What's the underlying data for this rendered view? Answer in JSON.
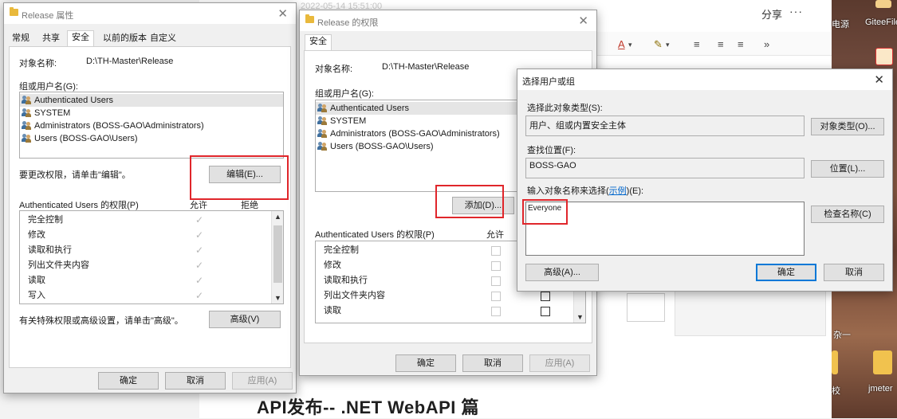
{
  "background": {
    "date_text": "2022-05-14 15:51:00",
    "share": "分享",
    "more": "···",
    "ribbon": [
      "A",
      "A",
      "≡",
      "≡",
      "≡",
      "»"
    ],
    "caption": "API发布--   .NET   WebAPI  篇",
    "desktop": {
      "top_label_1": "电源",
      "top_label_2": "GiteeFile",
      "mid_label": "杂一",
      "bottom_label_1": "校",
      "bottom_label_2": "jmeter"
    }
  },
  "props": {
    "title": "Release 属性",
    "tabs": [
      "常规",
      "共享",
      "安全",
      "以前的版本",
      "自定义"
    ],
    "object_label": "对象名称:",
    "object_value": "D:\\TH-Master\\Release",
    "group_label": "组或用户名(G):",
    "users": [
      "Authenticated Users",
      "SYSTEM",
      "Administrators (BOSS-GAO\\Administrators)",
      "Users (BOSS-GAO\\Users)"
    ],
    "hint_edit": "要更改权限，请单击\"编辑\"。",
    "edit_button": "编辑(E)...",
    "perm_title": "Authenticated Users 的权限(P)",
    "allow": "允许",
    "deny": "拒绝",
    "perms": [
      "完全控制",
      "修改",
      "读取和执行",
      "列出文件夹内容",
      "读取",
      "写入"
    ],
    "hint_adv": "有关特殊权限或高级设置，请单击\"高级\"。",
    "adv_button": "高级(V)",
    "ok": "确定",
    "cancel": "取消",
    "apply": "应用(A)"
  },
  "perm": {
    "title": "Release 的权限",
    "tab": "安全",
    "object_label": "对象名称:",
    "object_value": "D:\\TH-Master\\Release",
    "group_label": "组或用户名(G):",
    "users": [
      "Authenticated Users",
      "SYSTEM",
      "Administrators (BOSS-GAO\\Administrators)",
      "Users (BOSS-GAO\\Users)"
    ],
    "add_button": "添加(D)...",
    "perm_title": "Authenticated Users 的权限(P)",
    "allow": "允许",
    "perms": [
      "完全控制",
      "修改",
      "读取和执行",
      "列出文件夹内容",
      "读取"
    ],
    "ok": "确定",
    "cancel": "取消",
    "apply": "应用(A)"
  },
  "select": {
    "title": "选择用户或组",
    "type_label": "选择此对象类型(S):",
    "type_value": "用户、组或内置安全主体",
    "type_button": "对象类型(O)...",
    "loc_label": "查找位置(F):",
    "loc_value": "BOSS-GAO",
    "loc_button": "位置(L)...",
    "enter_label_pre": "输入对象名称来选择(",
    "enter_label_link": "示例",
    "enter_label_post": ")(E):",
    "enter_value": "Everyone",
    "check_button": "检查名称(C)",
    "adv_button": "高级(A)...",
    "ok": "确定",
    "cancel": "取消"
  },
  "colors": {
    "highlight": "#e0262b",
    "accent": "#0078d7"
  }
}
